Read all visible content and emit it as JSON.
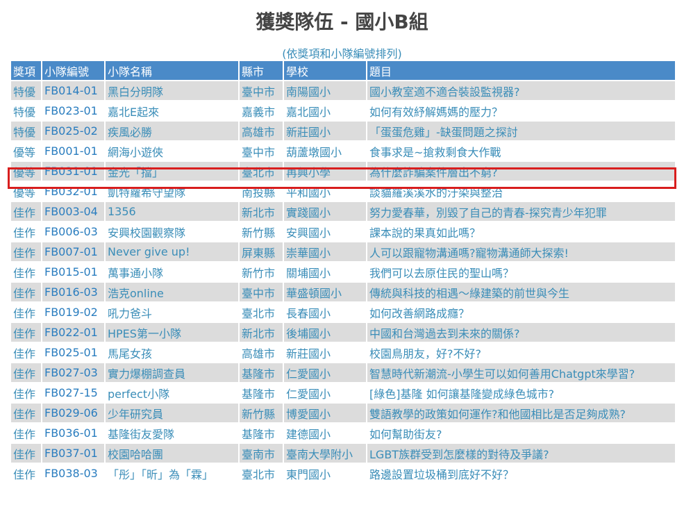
{
  "page": {
    "title": "獲獎隊伍 - 國小B組",
    "subtitle": "(依獎項和小隊編號排列)"
  },
  "table": {
    "headers": [
      "獎項",
      "小隊編號",
      "小隊名稱",
      "縣市",
      "學校",
      "題目"
    ],
    "rows": [
      [
        "特優",
        "FB014-01",
        "黑白分明隊",
        "臺中市",
        "南陽國小",
        "國小教室適不適合裝設監視器?"
      ],
      [
        "特優",
        "FB023-01",
        "嘉北E起來",
        "嘉義市",
        "嘉北國小",
        "如何有效紓解媽媽的壓力？"
      ],
      [
        "特優",
        "FB025-02",
        "疾風必勝",
        "高雄市",
        "新莊國小",
        "「蛋蛋危雞」-缺蛋問題之探討"
      ],
      [
        "優等",
        "FB001-01",
        "網海小遊俠",
        "臺中市",
        "葫蘆墩國小",
        "食事求是~搶救剩食大作戰"
      ],
      [
        "優等",
        "FB031-01",
        "金光「擋」",
        "臺北市",
        "再興小學",
        "為什麼詐騙案件層出不窮?"
      ],
      [
        "優等",
        "FB032-01",
        "凱特蘿希守望隊",
        "南投縣",
        "平和國小",
        "談貓羅溪溪水的汙染與整治"
      ],
      [
        "佳作",
        "FB003-04",
        "1356",
        "新北市",
        "實踐國小",
        "努力愛春華，別毀了自己的青春-探究青少年犯罪"
      ],
      [
        "佳作",
        "FB006-03",
        "安興校園觀察隊",
        "新竹縣",
        "安興國小",
        "課本說的果真如此嗎？"
      ],
      [
        "佳作",
        "FB007-01",
        "Never give up!",
        "屏東縣",
        "崇華國小",
        "人可以跟寵物溝通嗎?寵物溝通師大探索!"
      ],
      [
        "佳作",
        "FB015-01",
        "萬事通小隊",
        "新竹市",
        "關埔國小",
        "我們可以去原住民的聖山嗎？"
      ],
      [
        "佳作",
        "FB016-03",
        "浩克online",
        "臺中市",
        "華盛頓國小",
        "傳統與科技的相遇～綠建築的前世與今生"
      ],
      [
        "佳作",
        "FB019-02",
        "吼力爸斗",
        "臺北市",
        "長春國小",
        "如何改善網路成癮？"
      ],
      [
        "佳作",
        "FB022-01",
        "HPES第一小隊",
        "新北市",
        "後埔國小",
        "中國和台灣過去到未來的關係?"
      ],
      [
        "佳作",
        "FB025-01",
        "馬尾女孩",
        "高雄市",
        "新莊國小",
        "校園鳥朋友，好?不好?"
      ],
      [
        "佳作",
        "FB027-03",
        "實力爆棚調查員",
        "基隆市",
        "仁愛國小",
        "智慧時代新潮流-小學生可以如何善用Chatgpt來學習?"
      ],
      [
        "佳作",
        "FB027-15",
        "perfect小隊",
        "基隆市",
        "仁愛國小",
        "[綠色]基隆 如何讓基隆變成綠色城市?"
      ],
      [
        "佳作",
        "FB029-06",
        "少年研究員",
        "新竹縣",
        "博愛國小",
        "雙語教學的政策如何運作?和他國相比是否足夠成熟?"
      ],
      [
        "佳作",
        "FB036-01",
        "基隆街友愛隊",
        "基隆市",
        "建德國小",
        "如何幫助街友?"
      ],
      [
        "佳作",
        "FB037-01",
        "校園哈哈團",
        "臺南市",
        "臺南大學附小",
        "LGBT族群受到怎麼樣的對待及爭議?"
      ],
      [
        "佳作",
        "FB038-03",
        "「彤」「昕」為「霖」",
        "臺北市",
        "東門國小",
        "路邊設置垃圾桶到底好不好？"
      ]
    ],
    "highlighted_row": 4
  },
  "colors": {
    "header_bg": "#4a8ac8",
    "header_text": "#ffffff",
    "cell_text": "#3a8db8",
    "row_alt_bg": "#dcdcdc",
    "row_bg": "#ffffff",
    "highlight_border": "#d81e1e",
    "title_text": "#444444"
  }
}
